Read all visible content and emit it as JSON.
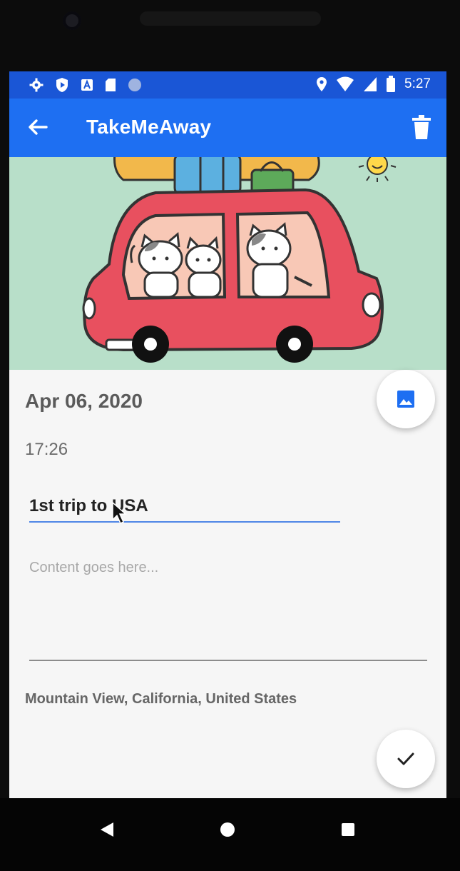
{
  "status_bar": {
    "time": "5:27",
    "left_icons": [
      "settings-icon",
      "shield-play-icon",
      "a-icon",
      "sd-card-icon",
      "dot-icon"
    ],
    "right_icons": [
      "location-icon",
      "wifi-icon",
      "signal-icon",
      "battery-icon"
    ]
  },
  "app_bar": {
    "title": "TakeMeAway",
    "back_icon": "arrow-back-icon",
    "delete_icon": "trash-icon",
    "color": "#1e6ff2"
  },
  "entry": {
    "date": "Apr 06, 2020",
    "time": "17:26",
    "title_value": "1st trip to USA",
    "content_placeholder": "Content goes here...",
    "location": "Mountain View, California, United States"
  },
  "fabs": {
    "image_icon": "image-icon",
    "save_icon": "check-icon",
    "accent": "#1e6ff2"
  },
  "nav_bar": {
    "icons": [
      "back-triangle-icon",
      "home-circle-icon",
      "recents-square-icon"
    ]
  }
}
